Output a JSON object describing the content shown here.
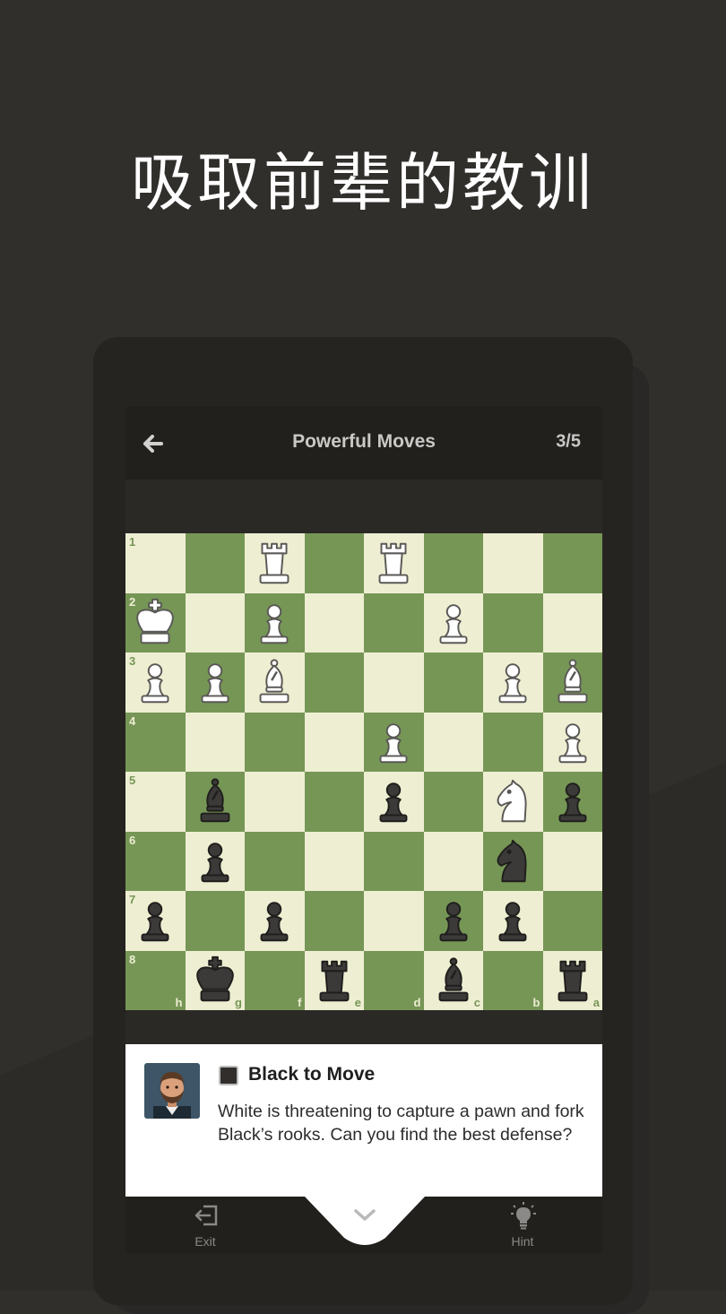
{
  "promo": {
    "title": "吸取前辈的教训"
  },
  "appbar": {
    "back_icon": "arrow-left-icon",
    "title": "Powerful Moves",
    "progress": "3/5"
  },
  "board": {
    "orientation": "black-bottom",
    "rank_labels": [
      "1",
      "2",
      "3",
      "4",
      "5",
      "6",
      "7",
      "8"
    ],
    "file_labels": [
      "h",
      "g",
      "f",
      "e",
      "d",
      "c",
      "b",
      "a"
    ],
    "light_color": "#eeeed2",
    "dark_color": "#769656",
    "rows": [
      [
        "",
        "",
        "wR",
        "",
        "wR",
        "",
        "",
        ""
      ],
      [
        "wK",
        "",
        "wP",
        "",
        "",
        "wP",
        "",
        ""
      ],
      [
        "wP",
        "wP",
        "wB",
        "",
        "",
        "",
        "wP",
        "wB"
      ],
      [
        "",
        "",
        "",
        "",
        "wP",
        "",
        "",
        "wP"
      ],
      [
        "",
        "bB",
        "",
        "",
        "bP",
        "",
        "wN",
        "bP"
      ],
      [
        "",
        "bP",
        "",
        "",
        "",
        "",
        "bN",
        ""
      ],
      [
        "bP",
        "",
        "bP",
        "",
        "",
        "bP",
        "bP",
        ""
      ],
      [
        "",
        "bK",
        "",
        "bR",
        "",
        "bB",
        "",
        "bR"
      ]
    ]
  },
  "coach": {
    "avatar_icon": "coach-avatar",
    "turn_label": "Black to Move",
    "message": "White is threatening to capture a pawn and fork Black’s rooks. Can you find the best defense?"
  },
  "bottombar": {
    "exit_label": "Exit",
    "exit_icon": "exit-door-icon",
    "expand_icon": "chevron-down-icon",
    "hint_label": "Hint",
    "hint_icon": "lightbulb-icon"
  }
}
